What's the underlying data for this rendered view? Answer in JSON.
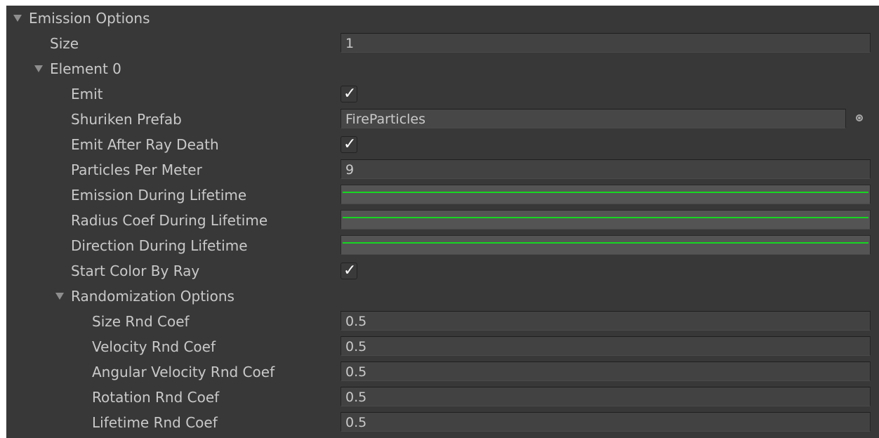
{
  "inspector": {
    "emission_options": {
      "label": "Emission Options",
      "size": {
        "label": "Size",
        "value": "1"
      },
      "element_0": {
        "label": "Element 0",
        "emit": {
          "label": "Emit",
          "checked": true,
          "mark": "✓"
        },
        "shuriken_prefab": {
          "label": "Shuriken Prefab",
          "value": "FireParticles",
          "picker_icon": "object-picker-icon"
        },
        "emit_after_ray_death": {
          "label": "Emit After Ray Death",
          "checked": true,
          "mark": "✓"
        },
        "particles_per_meter": {
          "label": "Particles Per Meter",
          "value": "9"
        },
        "emission_during_lifetime": {
          "label": "Emission During Lifetime",
          "curve_color": "#17d622"
        },
        "radius_coef_during_lifetime": {
          "label": "Radius Coef During Lifetime",
          "curve_color": "#17d622"
        },
        "direction_during_lifetime": {
          "label": "Direction During Lifetime",
          "curve_color": "#17d622"
        },
        "start_color_by_ray": {
          "label": "Start Color By Ray",
          "checked": true,
          "mark": "✓"
        },
        "randomization_options": {
          "label": "Randomization Options",
          "size_rnd_coef": {
            "label": "Size Rnd Coef",
            "value": "0.5"
          },
          "velocity_rnd_coef": {
            "label": "Velocity Rnd Coef",
            "value": "0.5"
          },
          "angular_velocity_rnd_coef": {
            "label": "Angular Velocity Rnd Coef",
            "value": "0.5"
          },
          "rotation_rnd_coef": {
            "label": "Rotation Rnd Coef",
            "value": "0.5"
          },
          "lifetime_rnd_coef": {
            "label": "Lifetime Rnd Coef",
            "value": "0.5"
          }
        }
      }
    }
  },
  "colors": {
    "panel_background": "#383838",
    "text": "#c9c9c9",
    "curve_green": "#17d622"
  }
}
